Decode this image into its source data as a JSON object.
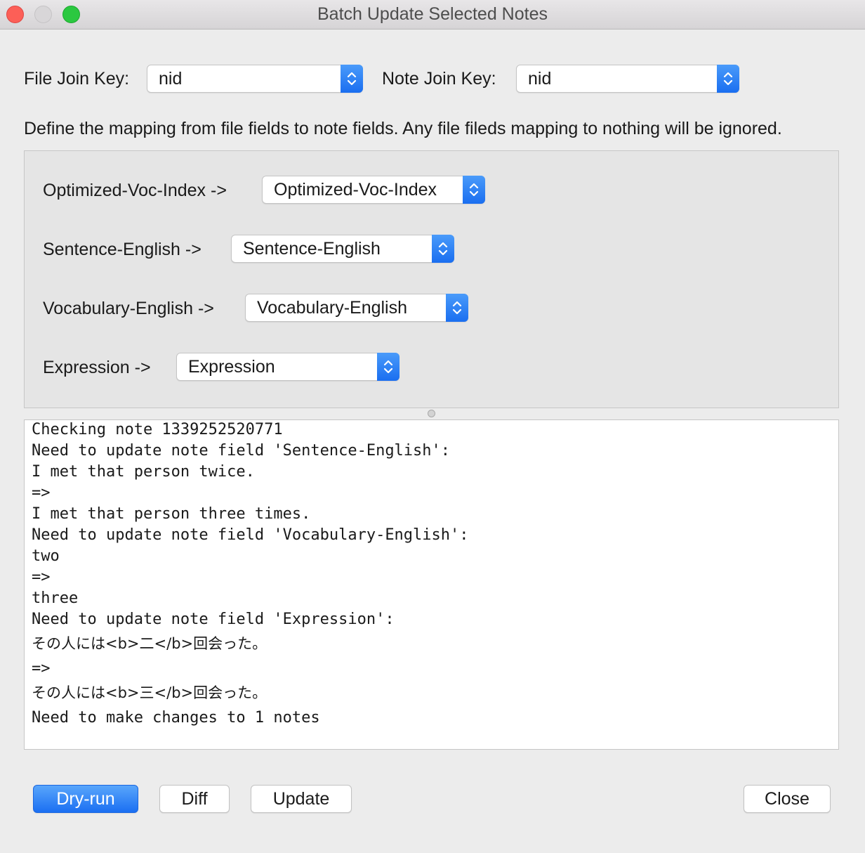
{
  "window": {
    "title": "Batch Update Selected Notes"
  },
  "join": {
    "file_label": "File Join Key:",
    "file_value": "nid",
    "note_label": "Note Join Key:",
    "note_value": "nid"
  },
  "instructions": "Define the mapping from file fields to note fields. Any file fileds mapping to nothing will be ignored.",
  "mappings": [
    {
      "from": "Optimized-Voc-Index ->",
      "to": "Optimized-Voc-Index"
    },
    {
      "from": "Sentence-English ->",
      "to": "Sentence-English"
    },
    {
      "from": "Vocabulary-English ->",
      "to": "Vocabulary-English"
    },
    {
      "from": "Expression ->",
      "to": "Expression"
    }
  ],
  "log": [
    "Checking note 1339252520771",
    "Need to update note field 'Sentence-English':",
    "I met that person twice.",
    "=>",
    "I met that person three times.",
    "Need to update note field 'Vocabulary-English':",
    "two",
    "=>",
    "three",
    "Need to update note field 'Expression':",
    "その人には<b>二</b>回会った。",
    "=>",
    "その人には<b>三</b>回会った。",
    "Need to make changes to 1 notes"
  ],
  "buttons": {
    "dry_run": "Dry-run",
    "diff": "Diff",
    "update": "Update",
    "close": "Close"
  },
  "colors": {
    "accent": "#1b6ff2",
    "close_dot": "#fc5f57",
    "zoom_dot": "#2bc840"
  }
}
